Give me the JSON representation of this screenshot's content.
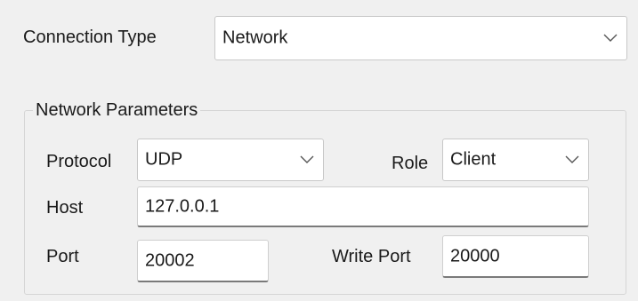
{
  "connection": {
    "label": "Connection Type",
    "selected": "Network"
  },
  "network": {
    "group_title": "Network Parameters",
    "protocol_label": "Protocol",
    "protocol_value": "UDP",
    "role_label": "Role",
    "role_value": "Client",
    "host_label": "Host",
    "host_value": "127.0.0.1",
    "port_label": "Port",
    "port_value": "20002",
    "write_port_label": "Write Port",
    "write_port_value": "20000"
  },
  "icons": {
    "dropdown": "chevron-down-icon"
  },
  "colors": {
    "background": "#f0f0f0",
    "field_bg": "#ffffff",
    "border": "#c8c8c8",
    "underline": "#7a7a7a",
    "text": "#1a1a1a"
  }
}
